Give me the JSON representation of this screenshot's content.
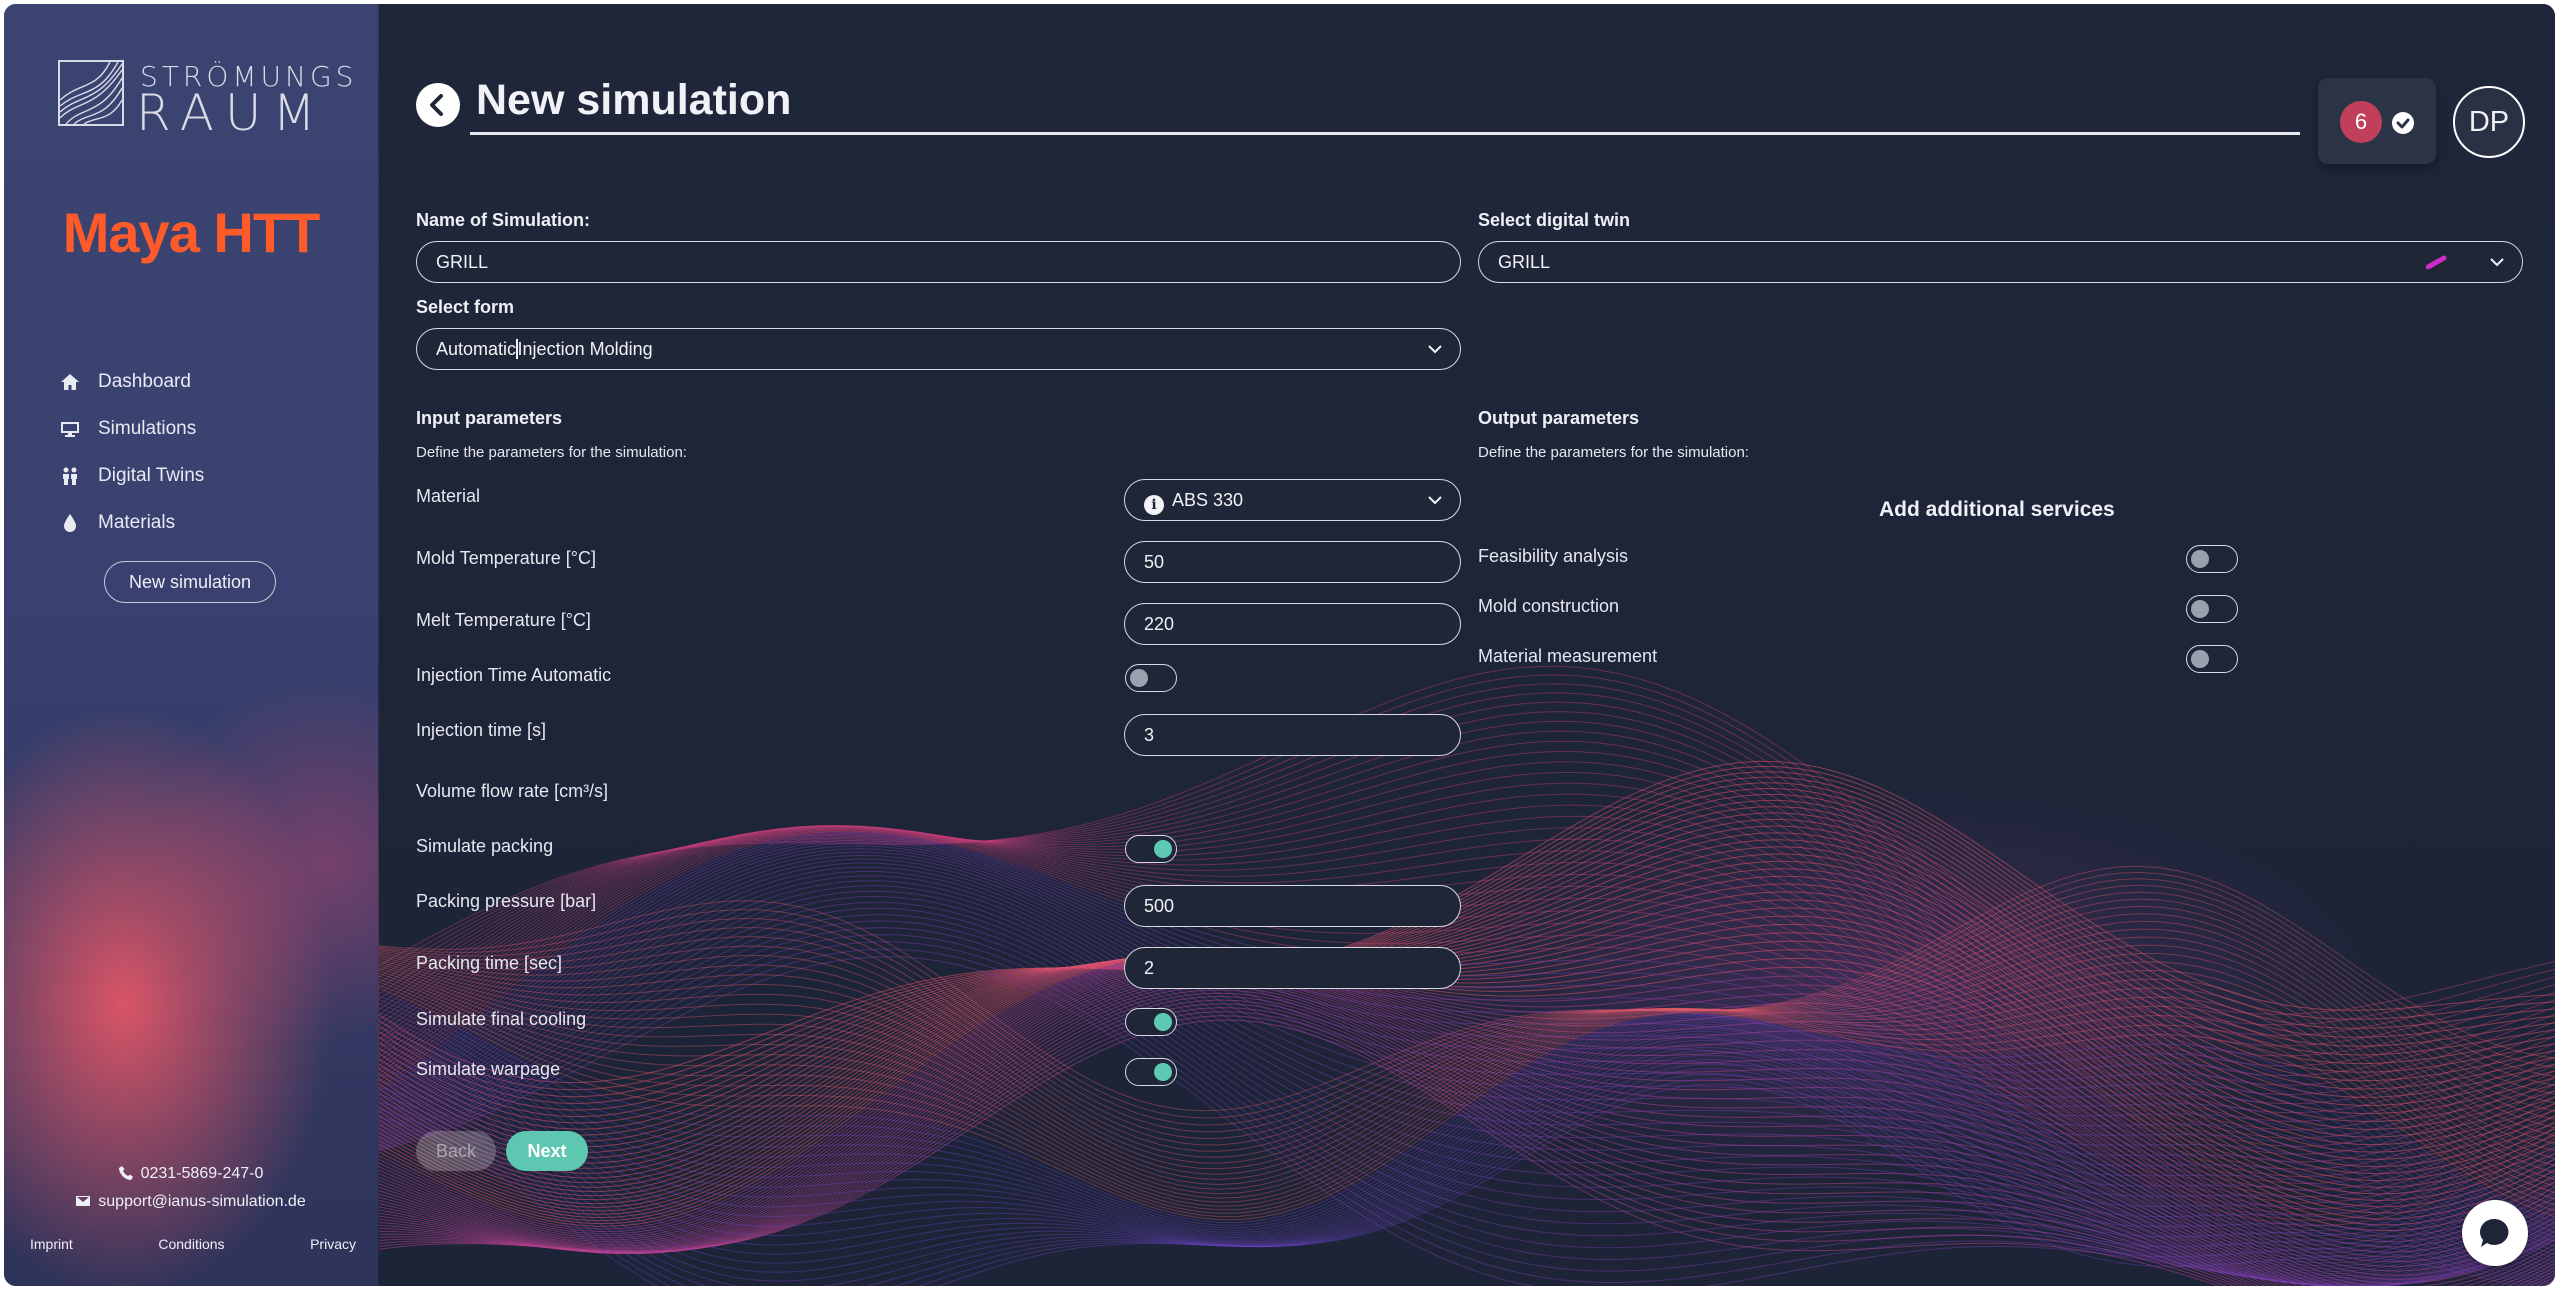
{
  "sidebar": {
    "logo": {
      "line1": "STRÖMUNGS",
      "line2": "RAUM"
    },
    "brand": "Maya HTT",
    "nav": [
      {
        "label": "Dashboard",
        "icon": "home-icon"
      },
      {
        "label": "Simulations",
        "icon": "monitor-icon"
      },
      {
        "label": "Digital Twins",
        "icon": "people-icon"
      },
      {
        "label": "Materials",
        "icon": "drop-icon"
      }
    ],
    "new_simulation_label": "New simulation",
    "phone": "0231-5869-247-0",
    "email": "support@ianus-simulation.de",
    "footer": {
      "imprint": "Imprint",
      "conditions": "Conditions",
      "privacy": "Privacy"
    }
  },
  "header": {
    "title": "New simulation",
    "notification_count": "6",
    "avatar_initials": "DP"
  },
  "form": {
    "name_label": "Name of Simulation:",
    "name_value": "GRILL",
    "twin_label": "Select digital twin",
    "twin_value": "GRILL",
    "form_label": "Select form",
    "form_value_before": "Automatic",
    "form_value_after": "Injection Molding"
  },
  "input": {
    "heading": "Input parameters",
    "subheading": "Define the parameters for the simulation:",
    "material_label": "Material",
    "material_value": "ABS 330",
    "mold_temp_label": "Mold Temperature [°C]",
    "mold_temp_value": "50",
    "melt_temp_label": "Melt Temperature [°C]",
    "melt_temp_value": "220",
    "inj_auto_label": "Injection Time Automatic",
    "inj_auto_on": false,
    "inj_time_label": "Injection time [s]",
    "inj_time_value": "3",
    "volume_flow_label": "Volume flow rate [cm³/s]",
    "sim_packing_label": "Simulate packing",
    "sim_packing_on": true,
    "packing_pressure_label": "Packing pressure [bar]",
    "packing_pressure_value": "500",
    "packing_time_label": "Packing time [sec]",
    "packing_time_value": "2",
    "final_cooling_label": "Simulate final cooling",
    "final_cooling_on": true,
    "warpage_label": "Simulate warpage",
    "warpage_on": true
  },
  "output": {
    "heading": "Output parameters",
    "subheading": "Define the parameters for the simulation:",
    "services_title": "Add additional services",
    "services": [
      {
        "label": "Feasibility analysis",
        "on": false
      },
      {
        "label": "Mold construction",
        "on": false
      },
      {
        "label": "Material measurement",
        "on": false
      }
    ]
  },
  "buttons": {
    "back": "Back",
    "next": "Next"
  },
  "colors": {
    "brand": "#ff5a2a",
    "accent": "#5dc7b1",
    "badge": "#c0405b",
    "background": "#1e2539"
  }
}
